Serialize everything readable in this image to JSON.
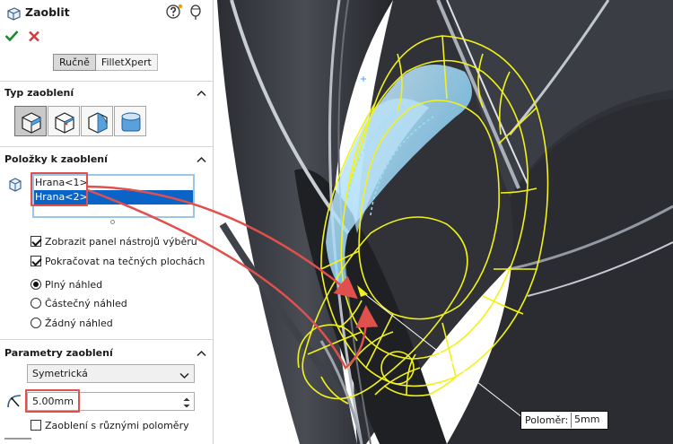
{
  "panel": {
    "title": "Zaoblit",
    "modes": [
      "Ručně",
      "FilletXpert"
    ],
    "active_mode": "Ručně"
  },
  "type_section": {
    "title": "Typ zaoblení",
    "buttons": [
      "constant-radius-fillet-icon",
      "variable-radius-fillet-icon",
      "face-fillet-icon",
      "full-round-fillet-icon"
    ],
    "selected_index": 0
  },
  "items_section": {
    "title": "Položky k zaoblení",
    "edges": [
      "Hrana<1>",
      "Hrana<2>"
    ],
    "selected_edge": "Hrana<2>",
    "options": [
      {
        "label": "Zobrazit panel nástrojů výběru",
        "checked": true
      },
      {
        "label": "Pokračovat na tečných plochách",
        "checked": true
      }
    ],
    "preview": [
      {
        "label": "Plný náhled",
        "checked": true
      },
      {
        "label": "Částečný náhled",
        "checked": false
      },
      {
        "label": "Žádný náhled",
        "checked": false
      }
    ]
  },
  "params_section": {
    "title": "Parametry zaoblení",
    "method": "Symetrická",
    "radius": "5.00mm",
    "multi_radius_label": "Zaoblení s různými poloměry",
    "multi_radius_checked": false
  },
  "viewport": {
    "callout_name": "Poloměr:",
    "callout_value": "5mm"
  },
  "colors": {
    "accent": "#0a63c7",
    "highlight": "#e0504d",
    "preview": "#f2f21a"
  }
}
